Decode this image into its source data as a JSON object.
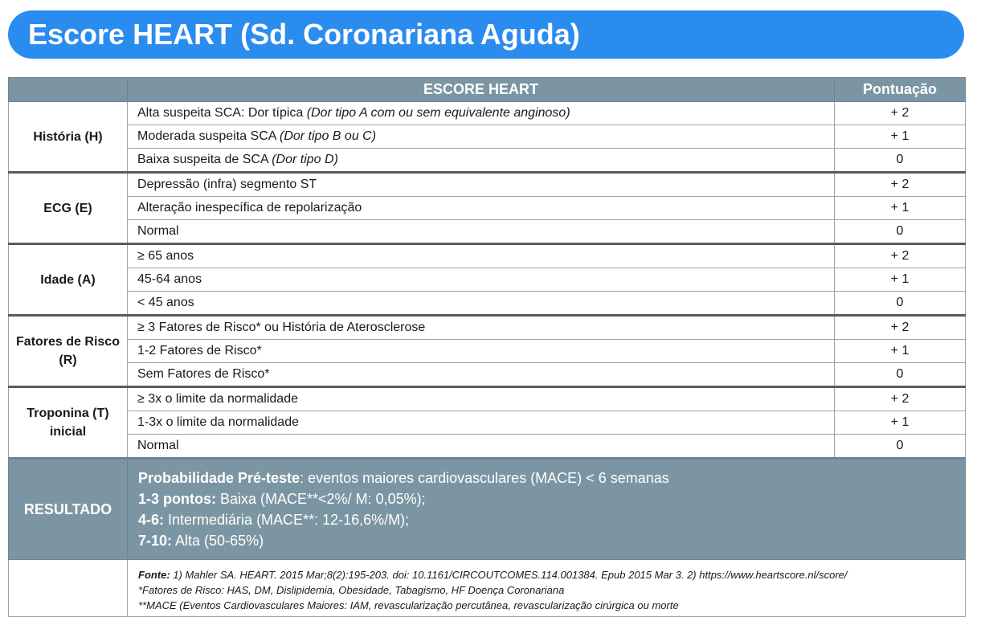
{
  "title": "Escore HEART (Sd. Coronariana Aguda)",
  "header": {
    "score": "ESCORE HEART",
    "points": "Pontuação"
  },
  "groups": [
    {
      "category": "História (H)",
      "rows": [
        {
          "text": "Alta suspeita SCA: Dor típica",
          "note": "(Dor tipo A com ou sem equivalente anginoso)",
          "points": "+ 2"
        },
        {
          "text": "Moderada suspeita SCA",
          "note": "(Dor tipo B ou C)",
          "points": "+ 1"
        },
        {
          "text": "Baixa suspeita de SCA",
          "note": "(Dor tipo D)",
          "points": "0"
        }
      ]
    },
    {
      "category": "ECG (E)",
      "rows": [
        {
          "text": "Depressão (infra) segmento ST",
          "note": "",
          "points": "+ 2"
        },
        {
          "text": "Alteração inespecífica de repolarização",
          "note": "",
          "points": "+ 1"
        },
        {
          "text": "Normal",
          "note": "",
          "points": "0"
        }
      ]
    },
    {
      "category": "Idade (A)",
      "rows": [
        {
          "text": "≥ 65 anos",
          "note": "",
          "points": "+ 2"
        },
        {
          "text": "45-64 anos",
          "note": "",
          "points": "+ 1"
        },
        {
          "text": "< 45 anos",
          "note": "",
          "points": "0"
        }
      ]
    },
    {
      "category": "Fatores de Risco (R)",
      "rows": [
        {
          "text": "≥ 3 Fatores de Risco* ou História de Aterosclerose",
          "note": "",
          "points": "+ 2"
        },
        {
          "text": "1-2 Fatores de Risco*",
          "note": "",
          "points": "+ 1"
        },
        {
          "text": "Sem Fatores de Risco*",
          "note": "",
          "points": "0"
        }
      ]
    },
    {
      "category": "Troponina (T) inicial",
      "rows": [
        {
          "text": "≥ 3x o limite da normalidade",
          "note": "",
          "points": "+ 2"
        },
        {
          "text": "1-3x o limite da normalidade",
          "note": "",
          "points": "+ 1"
        },
        {
          "text": "Normal",
          "note": "",
          "points": "0"
        }
      ]
    }
  ],
  "result": {
    "label": "RESULTADO",
    "lines": [
      {
        "bold": "Probabilidade Pré-teste",
        "text": ": eventos maiores cardiovasculares (MACE) < 6 semanas"
      },
      {
        "bold": "1-3 pontos:",
        "text": " Baixa (MACE**<2%/ M: 0,05%);"
      },
      {
        "bold": "4-6:",
        "text": " Intermediária (MACE**: 12-16,6%/M);"
      },
      {
        "bold": "7-10:",
        "text": " Alta (50-65%)"
      }
    ]
  },
  "footnote": {
    "source_label": "Fonte:",
    "source_text": " 1) Mahler SA. HEART. 2015 Mar;8(2):195-203. doi: 10.1161/CIRCOUTCOMES.114.001384. Epub 2015 Mar 3. 2) https://www.heartscore.nl/score/",
    "risk_factors": "*Fatores de Risco:  HAS, DM, Dislipidemia, Obesidade, Tabagismo, HF Doença Coronariana",
    "mace": "**MACE (Eventos Cardiovasculares Maiores: IAM, revascularização percutânea, revascularização cirúrgica ou morte"
  }
}
